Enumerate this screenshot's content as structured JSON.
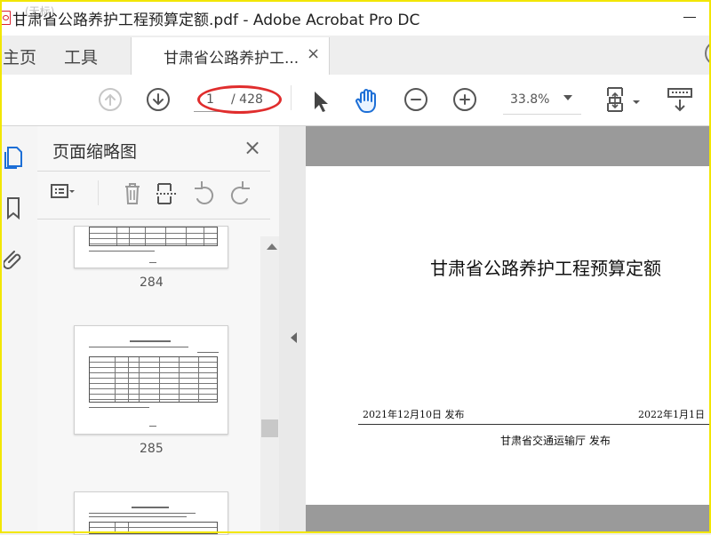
{
  "window": {
    "title": "甘肃省公路养护工程预算定额.pdf - Adobe Acrobat Pro DC",
    "ghost_text": "(无标)"
  },
  "tabs": {
    "home": "主页",
    "tools": "工具",
    "doc": "甘肃省公路养护工...",
    "close": "×"
  },
  "toolbar": {
    "page_current": "1",
    "page_total": "/ 428",
    "zoom": "33.8%"
  },
  "sidebar": {
    "title": "页面缩略图",
    "close": "×",
    "thumbnails": [
      {
        "page": "284"
      },
      {
        "page": "285"
      }
    ]
  },
  "document": {
    "title": "甘肃省公路养护工程预算定额",
    "published_left": "2021年12月10日  发布",
    "published_right": "2022年1月1日",
    "issuer": "甘肃省交通运输厅  发布"
  },
  "colors": {
    "accent": "#1d6fd6",
    "annotation": "#e02d2d",
    "frame": "#f2e600"
  }
}
